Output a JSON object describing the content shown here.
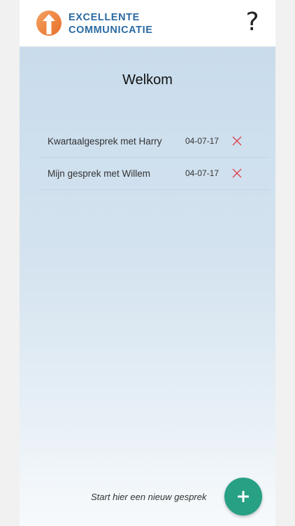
{
  "header": {
    "logo_line1": "EXCELLENTE",
    "logo_line2": "COMMUNICATIE",
    "help_label": "?",
    "logo_icon": "arrow-up-circle-icon"
  },
  "main": {
    "title": "Welkom",
    "conversations": [
      {
        "title": "Kwartaalgesprek met Harry",
        "date": "04-07-17"
      },
      {
        "title": "Mijn gesprek met Willem",
        "date": "04-07-17"
      }
    ],
    "new_hint": "Start hier een nieuw gesprek"
  },
  "colors": {
    "brand_blue": "#2b6aa1",
    "logo_orange": "#ee8a3b",
    "delete_red": "#e2404d",
    "fab_green": "#27a084"
  }
}
